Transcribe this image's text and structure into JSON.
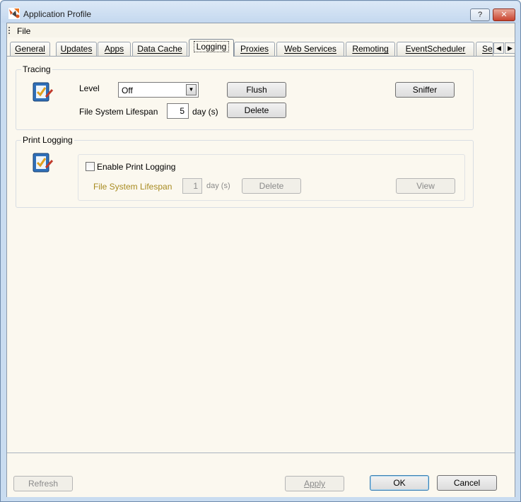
{
  "window": {
    "title": "Application Profile",
    "help_label": "?",
    "close_label": "✕"
  },
  "menu": {
    "file_label": "File"
  },
  "tabs": [
    {
      "label": "General"
    },
    {
      "label": "Updates"
    },
    {
      "label": "Apps"
    },
    {
      "label": "Data Cache"
    },
    {
      "label": "Logging"
    },
    {
      "label": "Proxies"
    },
    {
      "label": "Web Services"
    },
    {
      "label": "Remoting"
    },
    {
      "label": "EventScheduler"
    },
    {
      "label": "Se"
    }
  ],
  "active_tab": "Logging",
  "tracing": {
    "group_title": "Tracing",
    "level_label": "Level",
    "level_value": "Off",
    "lifespan_label": "File System Lifespan",
    "lifespan_value": "5",
    "lifespan_unit": "day (s)",
    "flush_label": "Flush",
    "delete_label": "Delete",
    "sniffer_label": "Sniffer"
  },
  "print_logging": {
    "group_title": "Print Logging",
    "enable_label": "Enable Print Logging",
    "enable_checked": false,
    "lifespan_label": "File System Lifespan",
    "lifespan_value": "1",
    "lifespan_unit": "day (s)",
    "delete_label": "Delete",
    "view_label": "View"
  },
  "footer": {
    "refresh_label": "Refresh",
    "apply_label": "Apply",
    "ok_label": "OK",
    "cancel_label": "Cancel"
  },
  "colors": {
    "disabled_label": "#a88b20",
    "window_frame": "#c9dcf0",
    "panel_bg": "#fbf8ef"
  }
}
